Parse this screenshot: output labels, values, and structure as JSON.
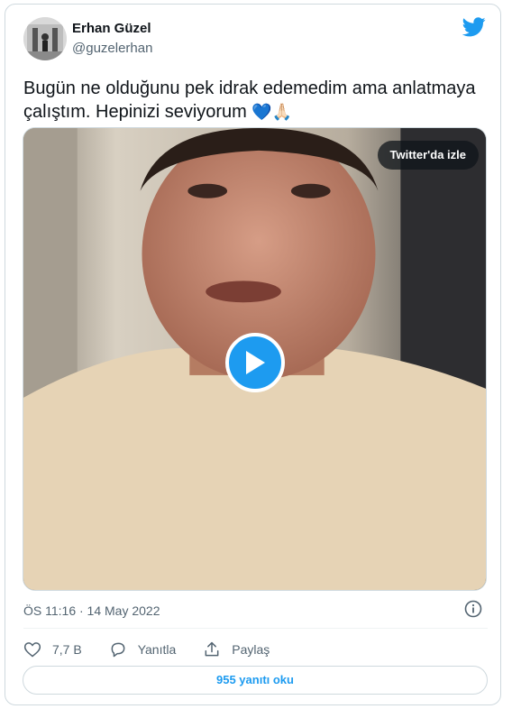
{
  "author": {
    "name": "Erhan Güzel",
    "handle": "@guzelerhan"
  },
  "tweet": {
    "text": "Bugün ne olduğunu pek idrak edemedim ama anlatmaya çalıştım. Hepinizi seviyorum",
    "emojis": "💙🙏🏻"
  },
  "video": {
    "watch_label": "Twitter'da izle"
  },
  "meta": {
    "timestamp": "ÖS 11:16 · 14 May 2022"
  },
  "actions": {
    "likes": "7,7 B",
    "reply_label": "Yanıtla",
    "share_label": "Paylaş"
  },
  "replies_button": "955 yanıtı oku",
  "colors": {
    "accent": "#1d9bf0",
    "secondary_text": "#536471",
    "border": "#cfd9de"
  },
  "icons": [
    "twitter-bird-icon",
    "play-icon",
    "info-icon",
    "heart-icon",
    "reply-icon",
    "share-icon"
  ]
}
